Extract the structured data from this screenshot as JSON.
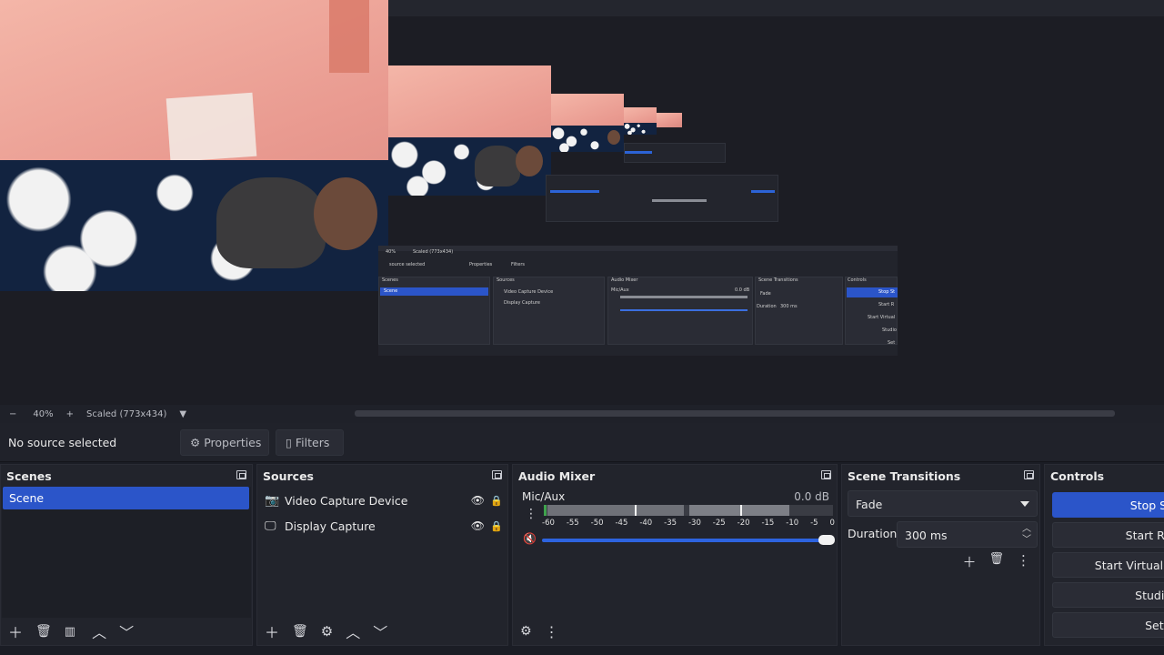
{
  "preview": {
    "mini_ui_texts": {
      "no_source": "source selected",
      "properties": "Properties",
      "filters": "Filters",
      "scenes": "Scenes",
      "scene": "Scene",
      "sources": "Sources",
      "video_capture": "Video Capture Device",
      "display_capture": "Display Capture",
      "audio_mixer": "Audio Mixer",
      "mic": "Mic/Aux",
      "mic_db": "0.0 dB",
      "scene_transitions": "Scene Transitions",
      "fade": "Fade",
      "duration": "Duration",
      "duration_value": "300 ms",
      "controls": "Controls",
      "stop": "Stop St",
      "start_rec": "Start R",
      "start_virtual": "Start Virtual",
      "studio": "Studio",
      "settings": "Set",
      "zoom": "40%",
      "scaled": "Scaled (773x434)"
    }
  },
  "status": {
    "minus": "−",
    "zoom": "40%",
    "plus": "+",
    "scaled": "Scaled (773x434)"
  },
  "propsbar": {
    "no_source": "No source selected",
    "properties": "Properties",
    "filters": "Filters"
  },
  "scenes": {
    "title": "Scenes",
    "items": [
      "Scene"
    ]
  },
  "sources": {
    "title": "Sources",
    "items": [
      {
        "label": "Video Capture Device",
        "icon": "camera-icon"
      },
      {
        "label": "Display Capture",
        "icon": "monitor-icon"
      }
    ]
  },
  "mixer": {
    "title": "Audio Mixer",
    "channel": "Mic/Aux",
    "db": "0.0 dB",
    "scale": [
      "-60",
      "-55",
      "-50",
      "-45",
      "-40",
      "-35",
      "-30",
      "-25",
      "-20",
      "-15",
      "-10",
      "-5",
      "0"
    ]
  },
  "transitions": {
    "title": "Scene Transitions",
    "selected": "Fade",
    "duration_label": "Duration",
    "duration_value": "300 ms"
  },
  "controls": {
    "title": "Controls",
    "buttons": [
      "Stop St",
      "Start Re",
      "Start Virtual (",
      "Studio",
      "Setti"
    ]
  },
  "colors": {
    "accent": "#2b55c9",
    "background": "#1b1d25"
  }
}
